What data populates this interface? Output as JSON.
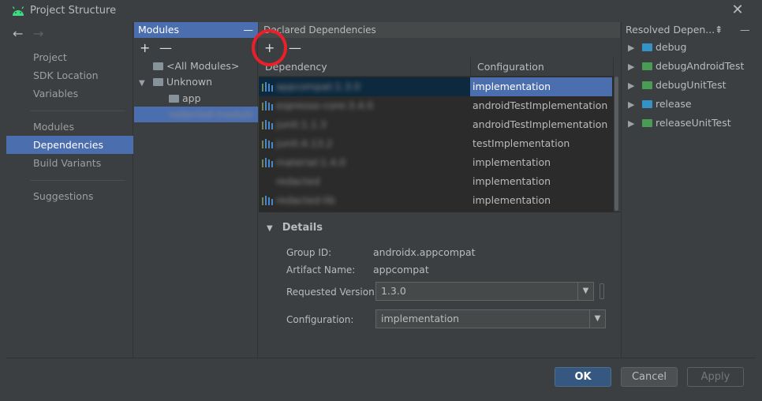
{
  "window": {
    "title": "Project Structure",
    "close_glyph": "✕"
  },
  "sidebar": {
    "back_glyph": "←",
    "forward_glyph": "→",
    "items": [
      {
        "label": "Project"
      },
      {
        "label": "SDK Location"
      },
      {
        "label": "Variables"
      },
      {
        "label": "Modules"
      },
      {
        "label": "Dependencies",
        "selected": true
      },
      {
        "label": "Build Variants"
      },
      {
        "label": "Suggestions"
      }
    ]
  },
  "modules_panel": {
    "header": "Modules",
    "minimize_glyph": "—",
    "add_glyph": "+",
    "remove_glyph": "—",
    "tree": [
      {
        "label": "<All Modules>"
      },
      {
        "label": "Unknown",
        "expanded": true
      },
      {
        "label": "app"
      },
      {
        "label": "redacted-module",
        "selected": true
      }
    ]
  },
  "declared": {
    "header": "Declared Dependencies",
    "add_glyph": "+",
    "remove_glyph": "—",
    "columns": [
      "Dependency",
      "Configuration"
    ],
    "rows": [
      {
        "dependency": "appcompat:1.3.0",
        "configuration": "implementation",
        "selected": true
      },
      {
        "dependency": "espresso-core:3.4.0",
        "configuration": "androidTestImplementation"
      },
      {
        "dependency": "junit:1.1.3",
        "configuration": "androidTestImplementation"
      },
      {
        "dependency": "junit:4.13.2",
        "configuration": "testImplementation"
      },
      {
        "dependency": "material:1.4.0",
        "configuration": "implementation"
      },
      {
        "dependency": "redacted",
        "configuration": "implementation"
      },
      {
        "dependency": "redacted-lib",
        "configuration": "implementation"
      }
    ]
  },
  "details": {
    "header": "Details",
    "group_id_label": "Group ID:",
    "group_id": "androidx.appcompat",
    "artifact_label": "Artifact Name:",
    "artifact": "appcompat",
    "requested_version_label": "Requested Version:",
    "requested_version": "1.3.0",
    "configuration_label": "Configuration:",
    "configuration": "implementation"
  },
  "resolved": {
    "header": "Resolved Depen...",
    "items": [
      {
        "label": "debug",
        "color": "blue"
      },
      {
        "label": "debugAndroidTest",
        "color": "green"
      },
      {
        "label": "debugUnitTest",
        "color": "green"
      },
      {
        "label": "release",
        "color": "blue"
      },
      {
        "label": "releaseUnitTest",
        "color": "green"
      }
    ]
  },
  "footer": {
    "ok": "OK",
    "cancel": "Cancel",
    "apply": "Apply"
  },
  "colors": {
    "selection": "#4b6eaf",
    "annotation": "#e8202a",
    "background": "#3c3f41"
  }
}
